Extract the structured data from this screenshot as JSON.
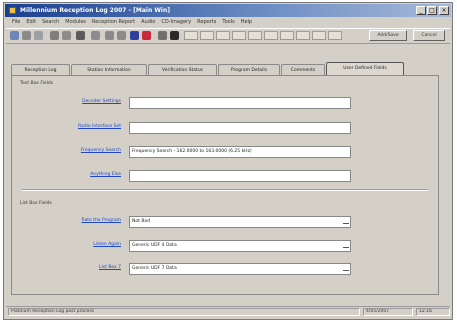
{
  "window": {
    "title": "Millennium Reception Log 2007 - [Main Win]"
  },
  "menu": [
    "File",
    "Edit",
    "Search",
    "Modules",
    "Reception Report",
    "Audio",
    "CD-Imagery",
    "Reports",
    "Tools",
    "Help"
  ],
  "toolbar": {
    "add_label": "Add/Save",
    "cancel_label": "Cancel"
  },
  "tabs": [
    "Reception Log",
    "Station Information",
    "Verification Status",
    "Program Details",
    "Comments",
    "User Defined Fields"
  ],
  "active_tab": "User Defined Fields",
  "form": {
    "text_box_title": "Text Box Fields",
    "list_box_title": "List Box Fields",
    "text_fields": [
      {
        "label": "Decoder Settings",
        "value": ""
      },
      {
        "label": "Radio Interface Set",
        "value": ""
      },
      {
        "label": "Frequency Search",
        "value": "Frequency Search - 162.0000 to 163.0000 (6.25 kHz)"
      },
      {
        "label": "Anything Else",
        "value": ""
      }
    ],
    "list_fields": [
      {
        "label": "Rate the Program",
        "value": "Not Bad"
      },
      {
        "label": "Listen Again",
        "value": "Generic UDF 4 Data"
      },
      {
        "label": "List Box 7",
        "value": "Generic UDF 7 Data"
      }
    ]
  },
  "status": {
    "message": "Platinum Reception Log post process",
    "date": "4/05/2007",
    "time": "12:16"
  }
}
